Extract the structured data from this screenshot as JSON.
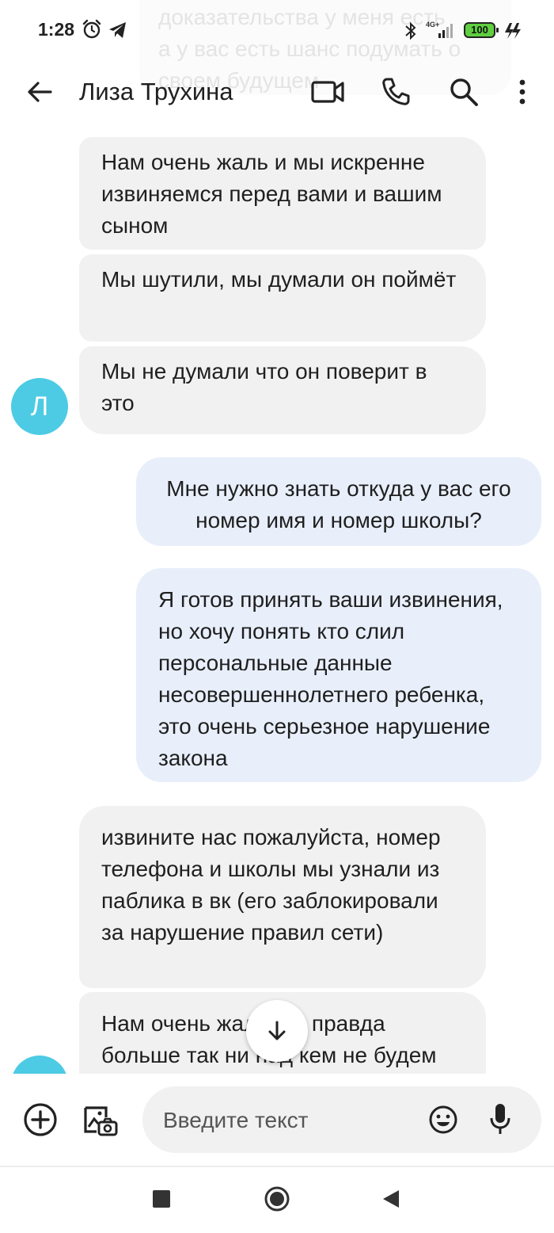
{
  "status_bar": {
    "time": "1:28",
    "network": "4G+",
    "battery": "100"
  },
  "ghost_overlay": {
    "lines": [
      "доказательства у меня есть",
      "а у вас есть шанс подумать о",
      "своем будущем"
    ]
  },
  "header": {
    "contact_name": "Лиза Трухина"
  },
  "contact": {
    "avatar_letter": "Л",
    "avatar_color": "#4dcbe4"
  },
  "messages": [
    {
      "direction": "incoming",
      "text": "Нам очень жаль и мы искренне извиняемся перед вами и вашим сыном"
    },
    {
      "direction": "incoming",
      "text": "Мы шутили, мы думали он поймёт"
    },
    {
      "direction": "incoming",
      "text": "Мы не думали что он поверит в это"
    },
    {
      "direction": "outgoing",
      "text": "Мне нужно знать откуда у вас его номер имя и номер школы?"
    },
    {
      "direction": "outgoing",
      "text": "Я готов принять ваши извинения, но хочу понять кто слил персональные данные несовершеннолетнего ребенка, это очень серьезное нарушение закона"
    },
    {
      "direction": "incoming",
      "text": "извините нас пожалуйста, номер телефона и школы мы узнали из паблика в вк (его заблокировали за нарушение правил сети)"
    },
    {
      "direction": "incoming",
      "text": "Нам очень жаль мы правда больше так ни над кем не будем глупо шутить"
    }
  ],
  "compose": {
    "placeholder": "Введите текст"
  },
  "colors": {
    "incoming_bubble": "#f1f1f1",
    "outgoing_bubble": "#e8effb",
    "battery": "#5fcf40"
  }
}
